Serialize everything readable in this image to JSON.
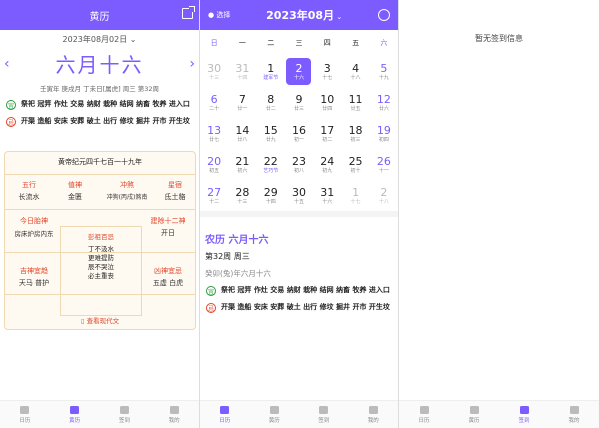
{
  "panel1": {
    "header_title": "黄历",
    "date_selector": "2023年08月02日",
    "lunar_big": "六月十六",
    "ganzhi": "壬寅年 庚戌月 丁未日[属虎] 周三 第32周",
    "yi_badge": "宜",
    "yi_text": "祭祀 冠笄 作灶 交易 纳财 栽种 结网 纳畜 牧养 进入口",
    "ji_badge": "忌",
    "ji_text": "开渠 造船 安床 安葬 破土 出行 修坟 掘井 开市 开生坟",
    "card": {
      "title": "黄帝纪元四千七百一十九年",
      "wuxing_k": "五行",
      "wuxing_v": "长流水",
      "zhishen_k": "值神",
      "zhishen_v": "金匮",
      "chongsha_k": "冲煞",
      "chongsha_v": "冲狗(丙戌)煞南",
      "xingxiu_k": "星宿",
      "xingxiu_v": "氐土貉",
      "taishen_k": "今日胎神",
      "taishen_v": "房床炉房内东",
      "jianchu_k": "建除十二神",
      "jianchu_v": "开日",
      "jishen_k": "吉神宜趋",
      "jishen_v": "天马 普护",
      "xiongshen_k": "凶神宜忌",
      "xiongshen_v": "五虚 白虎",
      "pengzu_k": "彭祖百忌",
      "pengzu_1": "丁不汲水",
      "pengzu_2": "更难提防",
      "pengzu_3": "辰不哭泣",
      "pengzu_4": "必主重丧",
      "view_more": "查看现代文"
    }
  },
  "panel2": {
    "location": "选择",
    "month": "2023年08月",
    "weekdays": [
      "日",
      "一",
      "二",
      "三",
      "四",
      "五",
      "六"
    ],
    "days": [
      {
        "n": "30",
        "l": "十三",
        "c": "ot"
      },
      {
        "n": "31",
        "l": "十四",
        "c": "ot"
      },
      {
        "n": "1",
        "l": "建军节",
        "c": "fest"
      },
      {
        "n": "2",
        "l": "十六",
        "c": "sel"
      },
      {
        "n": "3",
        "l": "十七",
        "c": ""
      },
      {
        "n": "4",
        "l": "十八",
        "c": ""
      },
      {
        "n": "5",
        "l": "十九",
        "c": "wk"
      },
      {
        "n": "6",
        "l": "二十",
        "c": "wk"
      },
      {
        "n": "7",
        "l": "廿一",
        "c": ""
      },
      {
        "n": "8",
        "l": "廿二",
        "c": ""
      },
      {
        "n": "9",
        "l": "廿三",
        "c": ""
      },
      {
        "n": "10",
        "l": "廿四",
        "c": ""
      },
      {
        "n": "11",
        "l": "廿五",
        "c": ""
      },
      {
        "n": "12",
        "l": "廿六",
        "c": "wk"
      },
      {
        "n": "13",
        "l": "廿七",
        "c": "wk"
      },
      {
        "n": "14",
        "l": "廿八",
        "c": ""
      },
      {
        "n": "15",
        "l": "廿九",
        "c": ""
      },
      {
        "n": "16",
        "l": "初一",
        "c": ""
      },
      {
        "n": "17",
        "l": "初二",
        "c": ""
      },
      {
        "n": "18",
        "l": "初三",
        "c": ""
      },
      {
        "n": "19",
        "l": "初四",
        "c": "wk"
      },
      {
        "n": "20",
        "l": "初五",
        "c": "wk"
      },
      {
        "n": "21",
        "l": "初六",
        "c": ""
      },
      {
        "n": "22",
        "l": "艺巧节",
        "c": "fest"
      },
      {
        "n": "23",
        "l": "初八",
        "c": ""
      },
      {
        "n": "24",
        "l": "初九",
        "c": ""
      },
      {
        "n": "25",
        "l": "初十",
        "c": ""
      },
      {
        "n": "26",
        "l": "十一",
        "c": "wk"
      },
      {
        "n": "27",
        "l": "十二",
        "c": "wk"
      },
      {
        "n": "28",
        "l": "十三",
        "c": ""
      },
      {
        "n": "29",
        "l": "十四",
        "c": ""
      },
      {
        "n": "30",
        "l": "十五",
        "c": ""
      },
      {
        "n": "31",
        "l": "十六",
        "c": ""
      },
      {
        "n": "1",
        "l": "十七",
        "c": "ot"
      },
      {
        "n": "2",
        "l": "十八",
        "c": "ot"
      }
    ],
    "nongli_title": "农历 六月十六",
    "week_line": "第32周 周三",
    "ganzhi_line": "癸卯(兔)年六月十六",
    "yi_badge": "宜",
    "yi_text": "祭祀 冠笄 作灶 交易 纳财 栽种 结网 纳畜 牧养 进入口",
    "ji_badge": "忌",
    "ji_text": "开渠 造船 安床 安葬 破土 出行 修坟 掘井 开市 开生坟"
  },
  "panel3": {
    "message": "暂无签到信息"
  },
  "tabs": [
    "日历",
    "黄历",
    "签到",
    "我的"
  ],
  "colors": {
    "accent": "#7d5cff",
    "red": "#e0442a",
    "green": "#2a9d3a"
  }
}
